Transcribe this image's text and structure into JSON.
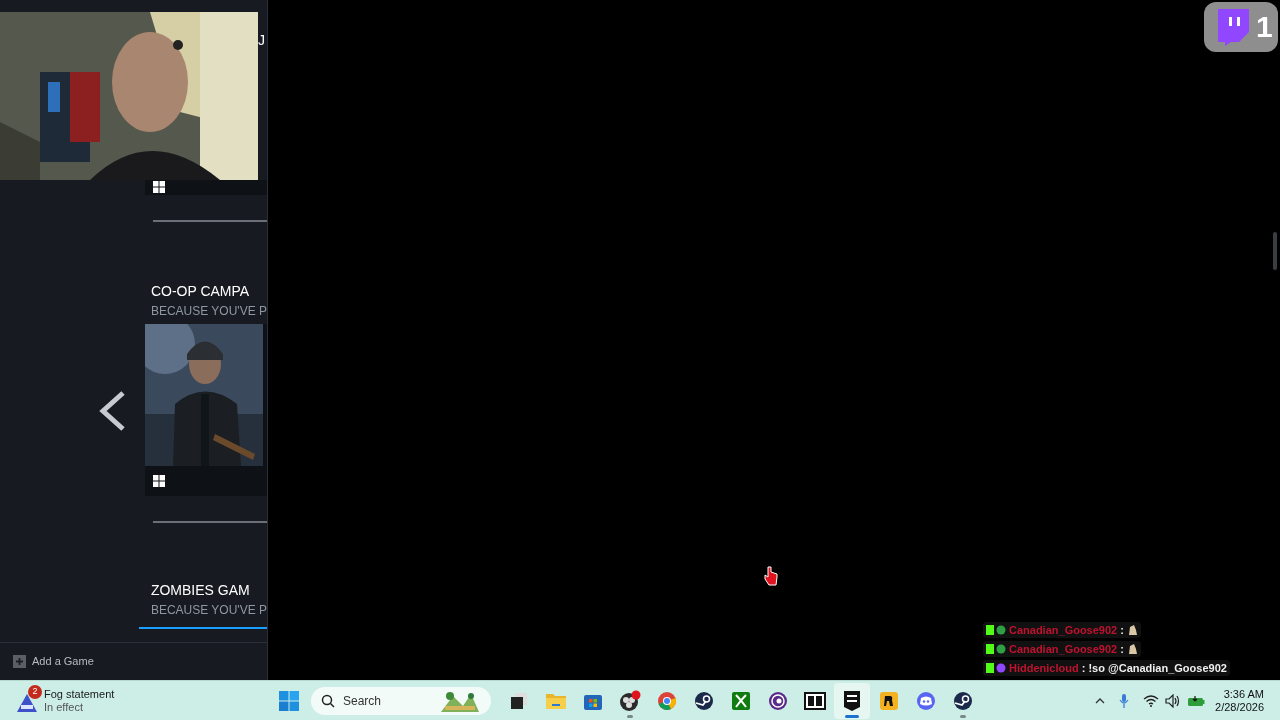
{
  "library": {
    "header_fragment": "J",
    "sections": [
      {
        "title": "CO-OP CAMPA",
        "subtitle": "BECAUSE YOU'VE P"
      },
      {
        "title": "ZOMBIES GAM",
        "subtitle": "BECAUSE YOU'VE P"
      }
    ],
    "add_game": "Add a Game"
  },
  "chat": [
    {
      "user": "Canadian_Goose902",
      "separator": ":"
    },
    {
      "user": "Canadian_Goose902",
      "separator": ":"
    },
    {
      "user": "Hiddenicloud",
      "separator": ":",
      "text": "!so @Canadian_Goose902"
    }
  ],
  "alert_badge": {
    "count": "1"
  },
  "taskbar": {
    "weather": {
      "title": "Fog statement",
      "subtitle": "In effect",
      "badge": "2"
    },
    "search": {
      "placeholder": "Search"
    },
    "apps": [
      {
        "kind": "taskview",
        "running": false,
        "selected": false
      },
      {
        "kind": "folder",
        "running": false,
        "selected": false
      },
      {
        "kind": "store",
        "running": false,
        "selected": false
      },
      {
        "kind": "obs",
        "running": true,
        "selected": false
      },
      {
        "kind": "chrome",
        "running": false,
        "selected": false
      },
      {
        "kind": "steam",
        "running": false,
        "selected": false
      },
      {
        "kind": "xbox",
        "running": false,
        "selected": false
      },
      {
        "kind": "ubisoft",
        "running": false,
        "selected": false
      },
      {
        "kind": "zip",
        "running": false,
        "selected": false
      },
      {
        "kind": "epic",
        "running": true,
        "selected": true
      },
      {
        "kind": "rockstar",
        "running": false,
        "selected": false
      },
      {
        "kind": "discord",
        "running": false,
        "selected": false
      },
      {
        "kind": "steam",
        "running": true,
        "selected": false
      }
    ],
    "time": "3:36 AM",
    "date": "2/28/2026"
  }
}
